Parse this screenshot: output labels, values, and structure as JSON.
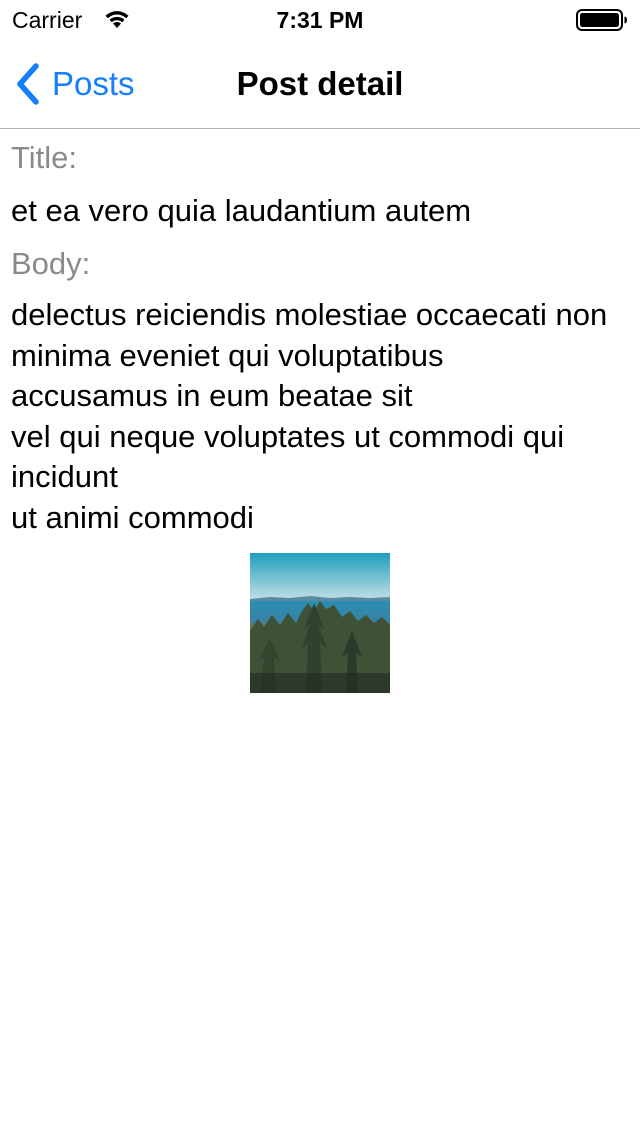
{
  "status_bar": {
    "carrier": "Carrier",
    "time": "7:31 PM",
    "wifi_icon": "wifi-icon",
    "battery_icon": "battery-full-icon"
  },
  "nav": {
    "back_label": "Posts",
    "back_icon": "chevron-left-icon",
    "title": "Post detail",
    "accent_color": "#147efb"
  },
  "post": {
    "title_label": "Title:",
    "title": "et ea vero quia laudantium autem",
    "body_label": "Body:",
    "body": "delectus reiciendis molestiae occaecati non minima eveniet qui voluptatibus\naccusamus in eum beatae sit\nvel qui neque voluptates ut commodi qui incidunt\nut animi commodi",
    "image": "landscape-photo"
  }
}
